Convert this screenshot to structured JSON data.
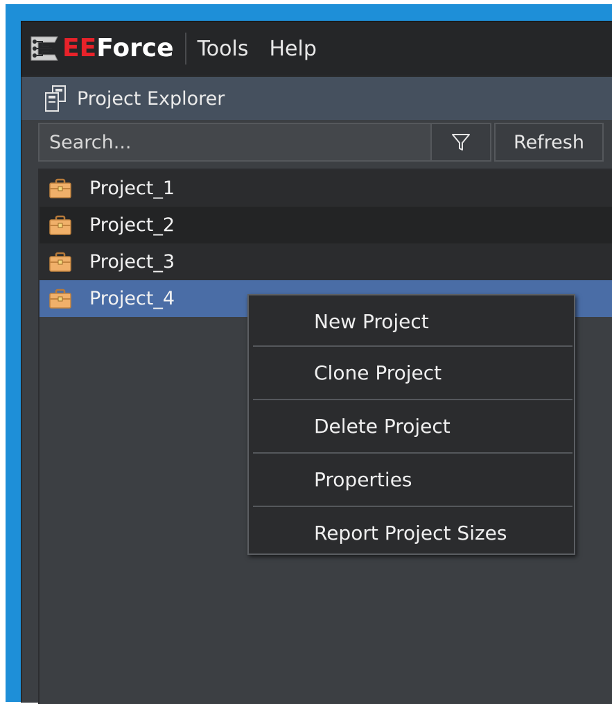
{
  "app": {
    "logo_text_red": "EE",
    "logo_text_white": "Force",
    "brand_color": "#e8222a"
  },
  "menubar": {
    "items": [
      {
        "label": "Tools"
      },
      {
        "label": "Help"
      }
    ]
  },
  "panel": {
    "title": "Project Explorer",
    "icon": "project-explorer-icon"
  },
  "toolbar": {
    "search_placeholder": "Search...",
    "filter_icon": "filter-icon",
    "refresh_label": "Refresh"
  },
  "projects": [
    {
      "label": "Project_1",
      "icon": "briefcase-icon",
      "selected": false
    },
    {
      "label": "Project_2",
      "icon": "briefcase-icon",
      "selected": false
    },
    {
      "label": "Project_3",
      "icon": "briefcase-icon",
      "selected": false
    },
    {
      "label": "Project_4",
      "icon": "briefcase-icon",
      "selected": true
    }
  ],
  "context_menu": {
    "items": [
      {
        "label": "New Project"
      },
      {
        "label": "Clone Project"
      },
      {
        "label": "Delete Project"
      },
      {
        "label": "Properties"
      },
      {
        "label": "Report Project Sizes"
      }
    ]
  },
  "colors": {
    "selection": "#4a6da6",
    "desktop": "#1e8fd8",
    "panel_header": "#45505e"
  }
}
